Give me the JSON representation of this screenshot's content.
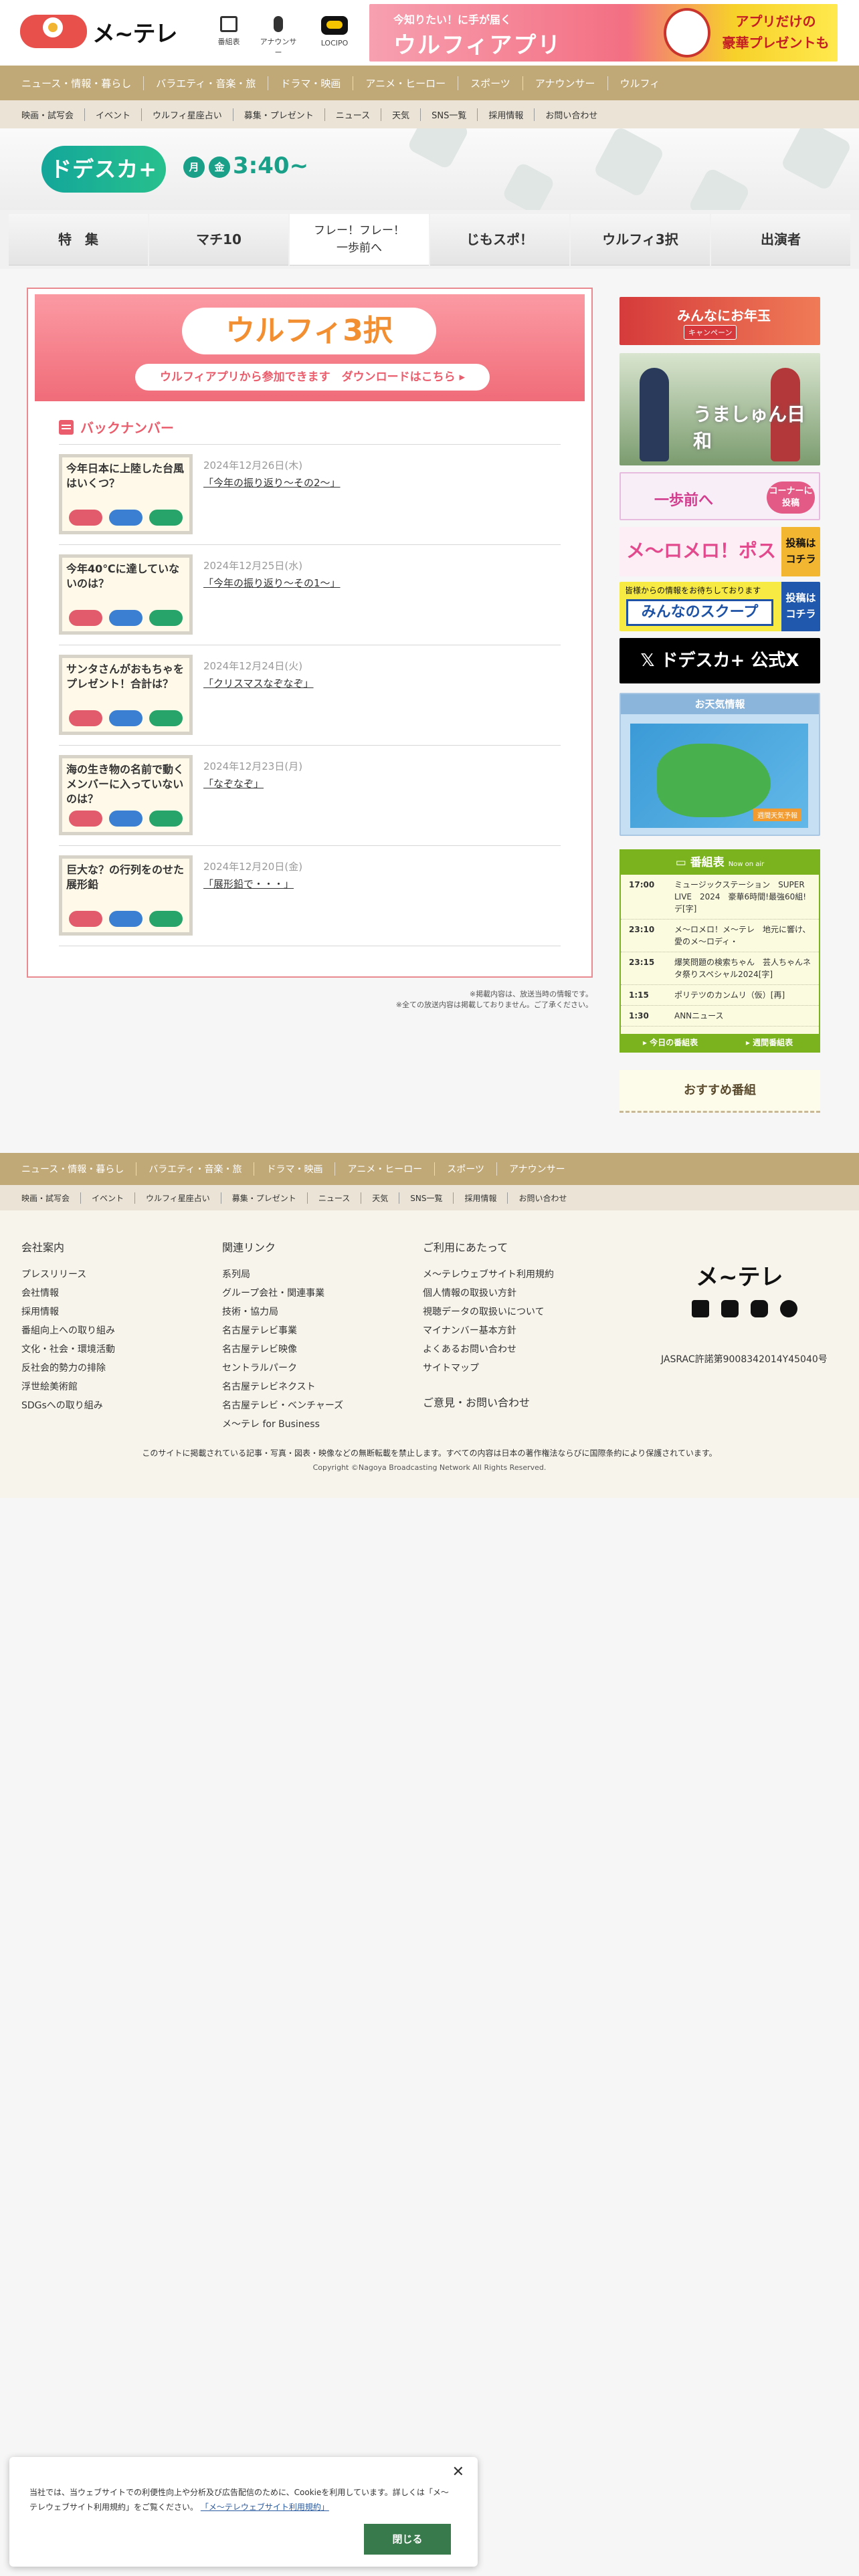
{
  "header": {
    "logo_text": "メ~テレ",
    "icons": [
      {
        "name": "tv-icon",
        "label": "番組表"
      },
      {
        "name": "microphone-icon",
        "label": "アナウンサー"
      },
      {
        "name": "locipo-icon",
        "label": "LOCIPO"
      }
    ],
    "banner": {
      "sub": "今知りたい！に手が届く",
      "title": "ウルフィアプリ",
      "right": "アプリだけの\n豪華プレゼントも"
    }
  },
  "nav_primary": [
    "ニュース・情報・暮らし",
    "バラエティ・音楽・旅",
    "ドラマ・映画",
    "アニメ・ヒーロー",
    "スポーツ",
    "アナウンサー",
    "ウルフィ"
  ],
  "nav_secondary": [
    "映画・試写会",
    "イベント",
    "ウルフィ星座占い",
    "募集・プレゼント",
    "ニュース",
    "天気",
    "SNS一覧",
    "採用情報",
    "お問い合わせ"
  ],
  "program": {
    "logo": "ドデスカ+",
    "days": [
      "月",
      "金"
    ],
    "time": "3:40~"
  },
  "tabs": [
    "特　集",
    "マチ10",
    "フレー！フレー！\n一歩前へ",
    "じもスポ！",
    "ウルフィ3択",
    "出演者"
  ],
  "main": {
    "banner_logo": "ウルフィ3択",
    "banner_button": "ウルフィアプリから参加できます　ダウンロードはこちら ▸",
    "section_title": "バックナンバー",
    "items": [
      {
        "thumb": "今年日本に上陸した台風はいくつ？",
        "date": "2024年12月26日(木)",
        "title": "「今年の振り返り〜その2〜」"
      },
      {
        "thumb": "今年40℃に達していないのは？",
        "date": "2024年12月25日(水)",
        "title": "「今年の振り返り〜その1〜」"
      },
      {
        "thumb": "サンタさんがおもちゃをプレゼント！合計は？",
        "date": "2024年12月24日(火)",
        "title": "「クリスマスなぞなぞ」"
      },
      {
        "thumb": "海の生き物の名前で動くメンバーに入っていないのは？",
        "date": "2024年12月23日(月)",
        "title": "「なぞなぞ」"
      },
      {
        "thumb": "巨大な？の行列をのせた展形鉛",
        "date": "2024年12月20日(金)",
        "title": "「展形鉛で・・・」"
      }
    ],
    "note1": "※掲載内容は、放送当時の情報です。",
    "note2": "※全ての放送内容は掲載しておりません。ご了承ください。"
  },
  "sidebar": {
    "newyear": {
      "title": "みんなにお年玉",
      "sub": "キャンペーン"
    },
    "umashun": {
      "title": "うましゅん日和"
    },
    "ippo": {
      "title": "一歩前へ",
      "button": "コーナーに\n投稿"
    },
    "post": {
      "title": "メ〜ロメロ！ポスト",
      "button": "投稿は\nコチラ"
    },
    "scoop": {
      "sub": "皆様からの情報をお待ちしております",
      "title": "みんなのスクープ",
      "button": "投稿は\nコチラ"
    },
    "x": {
      "label": "𝕏 ドデスカ+ 公式X"
    },
    "weather": {
      "title": "お天気情報",
      "label": "週間天気予報"
    },
    "schedule": {
      "title": "番組表",
      "title_sub": "Now on air",
      "rows": [
        {
          "time": "17:00",
          "program": "ミュージックステーション　SUPER　LIVE　2024　豪華6時間!最強60組!デ[字]"
        },
        {
          "time": "23:10",
          "program": "メ〜ロメロ！メ〜テレ　地元に響け、愛のメ〜ロディ・"
        },
        {
          "time": "23:15",
          "program": "爆笑問題の検索ちゃん　芸人ちゃんネタ祭りスペシャル2024[字]"
        },
        {
          "time": "1:15",
          "program": "ポリテツのカンムリ（仮）[再]"
        },
        {
          "time": "1:30",
          "program": "ANNニュース"
        }
      ],
      "today_link": "▸ 今日の番組表",
      "week_link": "▸ 週間番組表"
    },
    "osusume": "おすすめ番組"
  },
  "footer_nav_primary": [
    "ニュース・情報・暮らし",
    "バラエティ・音楽・旅",
    "ドラマ・映画",
    "アニメ・ヒーロー",
    "スポーツ",
    "アナウンサー"
  ],
  "footer_nav_secondary": [
    "映画・試写会",
    "イベント",
    "ウルフィ星座占い",
    "募集・プレゼント",
    "ニュース",
    "天気",
    "SNS一覧",
    "採用情報",
    "お問い合わせ"
  ],
  "footer": {
    "col1": {
      "title": "会社案内",
      "items": [
        "プレスリリース",
        "会社情報",
        "採用情報",
        "番組向上への取り組み",
        "文化・社会・環境活動",
        "反社会的勢力の排除",
        "浮世絵美術館",
        "SDGsへの取り組み"
      ]
    },
    "col2": {
      "title": "関連リンク",
      "items": [
        "系列局",
        "グループ会社・関連事業",
        "技術・協力局",
        "名古屋テレビ事業",
        "名古屋テレビ映像",
        "セントラルパーク",
        "名古屋テレビネクスト",
        "名古屋テレビ・ベンチャーズ",
        "メ〜テレ for Business"
      ]
    },
    "col3": {
      "title": "ご利用にあたって",
      "items": [
        "メ〜テレウェブサイト利用規約",
        "個人情報の取扱い方針",
        "視聴データの取扱いについて",
        "マイナンバー基本方針",
        "よくあるお問い合わせ",
        "サイトマップ"
      ],
      "extra": "ご意見・お問い合わせ"
    },
    "logo": "メ~テレ",
    "jasrac": "JASRAC許諾第9008342014Y45040号",
    "copy1": "このサイトに掲載されている記事・写真・図表・映像などの無断転載を禁止します。すべての内容は日本の著作権法ならびに国際条約により保護されています。",
    "copy2": "Copyright ©Nagoya Broadcasting Network All Rights Reserved."
  },
  "cookie": {
    "text": "当社では、当ウェブサイトでの利便性向上や分析及び広告配信のために、Cookieを利用しています。詳しくは「メ〜テレウェブサイト利用規約」をご覧ください。",
    "link": "「メ〜テレウェブサイト利用規約」",
    "close": "✕",
    "button": "閉じる"
  }
}
